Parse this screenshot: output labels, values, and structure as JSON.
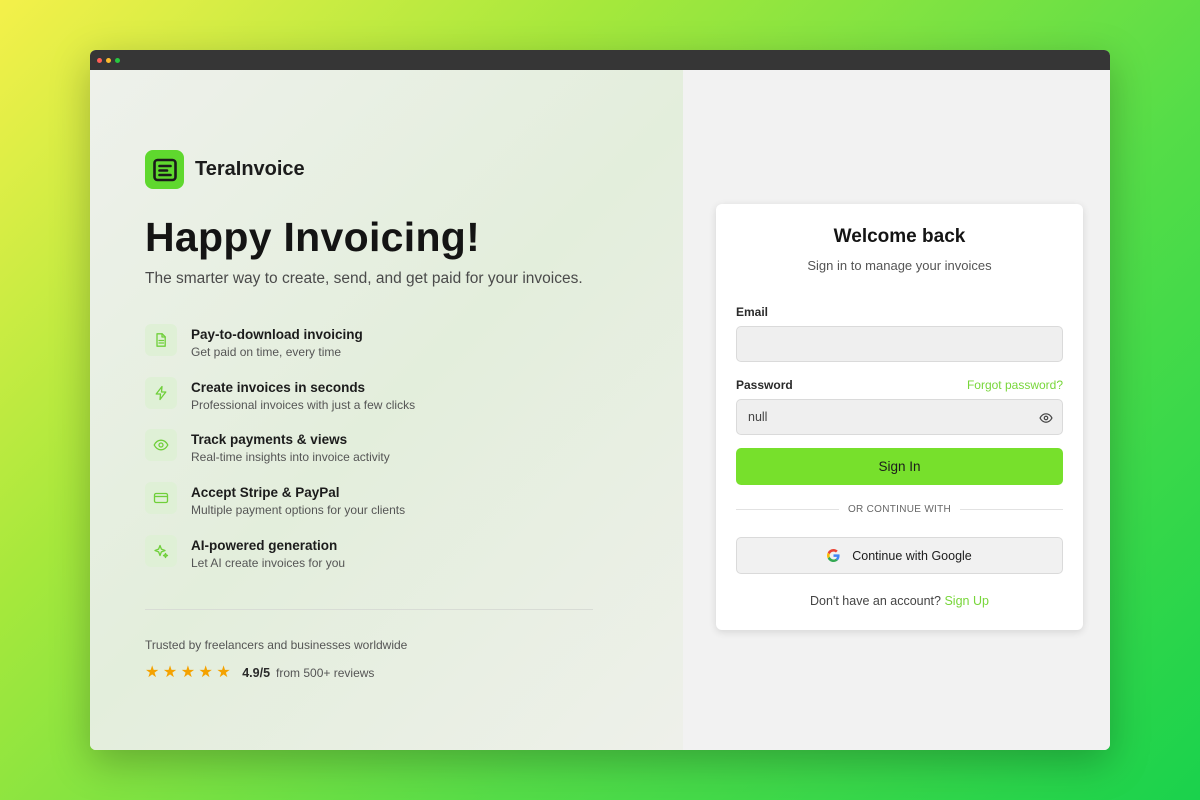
{
  "window": {
    "dots": [
      "#ff5f57",
      "#febc2e",
      "#28c840"
    ]
  },
  "brand": {
    "name": "TeraInvoice",
    "logo_icon": "invoice-document-icon",
    "accent_color": "#5fd82e"
  },
  "hero": {
    "title": "Happy Invoicing!",
    "subtitle": "The smarter way to create, send, and get paid for your invoices."
  },
  "features": [
    {
      "icon": "document-icon",
      "title": "Pay-to-download invoicing",
      "desc": "Get paid on time, every time"
    },
    {
      "icon": "lightning-icon",
      "title": "Create invoices in seconds",
      "desc": "Professional invoices with just a few clicks"
    },
    {
      "icon": "eye-icon",
      "title": "Track payments & views",
      "desc": "Real-time insights into invoice activity"
    },
    {
      "icon": "credit-card-icon",
      "title": "Accept Stripe & PayPal",
      "desc": "Multiple payment options for your clients"
    },
    {
      "icon": "sparkles-icon",
      "title": "AI-powered generation",
      "desc": "Let AI create invoices for you"
    }
  ],
  "social_proof": {
    "trusted_text": "Trusted by freelancers and businesses worldwide",
    "stars": 5,
    "score": "4.9/5",
    "reviews": "from 500+ reviews",
    "star_color": "#f4a200"
  },
  "login": {
    "title": "Welcome back",
    "subtitle": "Sign in to manage your invoices",
    "email_label": "Email",
    "email_value": "",
    "password_label": "Password",
    "forgot_label": "Forgot password?",
    "password_value": "null",
    "show_password_icon": "eye-icon",
    "signin_label": "Sign In",
    "divider_text": "OR CONTINUE WITH",
    "google_label": "Continue with Google",
    "google_icon": "google-icon",
    "no_account_text": "Don't have an account?",
    "signup_label": "Sign Up",
    "button_color": "#77e02c",
    "link_color": "#78d63a"
  }
}
